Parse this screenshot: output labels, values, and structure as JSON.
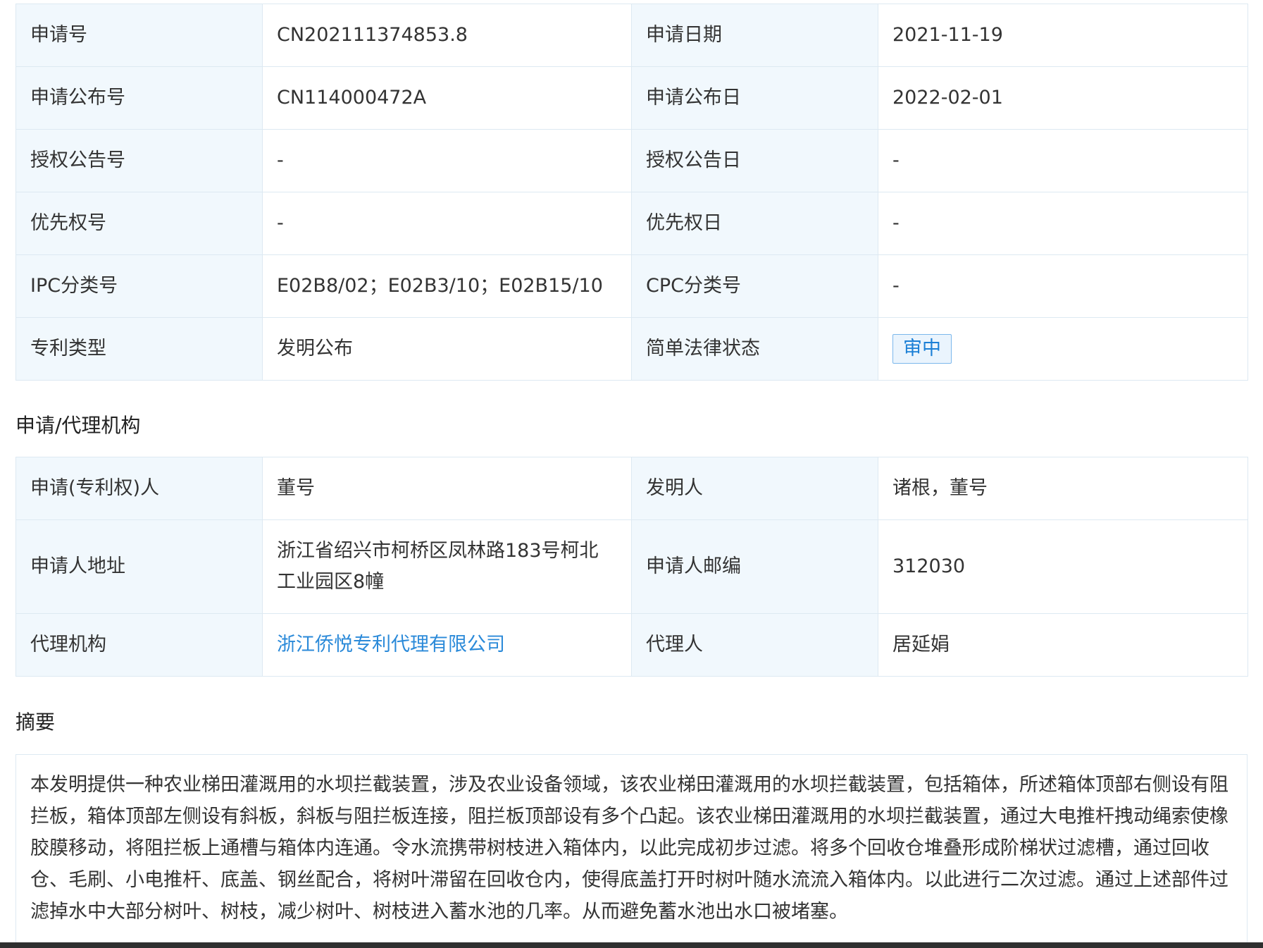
{
  "basic_info": {
    "rows": [
      {
        "k1": "申请号",
        "v1": "CN202111374853.8",
        "k2": "申请日期",
        "v2": "2021-11-19"
      },
      {
        "k1": "申请公布号",
        "v1": "CN114000472A",
        "k2": "申请公布日",
        "v2": "2022-02-01"
      },
      {
        "k1": "授权公告号",
        "v1": "-",
        "k2": "授权公告日",
        "v2": "-"
      },
      {
        "k1": "优先权号",
        "v1": "-",
        "k2": "优先权日",
        "v2": "-"
      },
      {
        "k1": "IPC分类号",
        "v1": "E02B8/02；E02B3/10；E02B15/10",
        "k2": "CPC分类号",
        "v2": "-"
      },
      {
        "k1": "专利类型",
        "v1": "发明公布",
        "k2": "简单法律状态",
        "v2": "审中"
      }
    ]
  },
  "agency_section": {
    "title": "申请/代理机构",
    "rows": [
      {
        "k1": "申请(专利权)人",
        "v1": "董号",
        "k2": "发明人",
        "v2": "诸根，董号"
      },
      {
        "k1": "申请人地址",
        "v1": "浙江省绍兴市柯桥区凤林路183号柯北工业园区8幢",
        "k2": "申请人邮编",
        "v2": "312030"
      },
      {
        "k1": "代理机构",
        "v1": "浙江侨悦专利代理有限公司",
        "k2": "代理人",
        "v2": "居延娟"
      }
    ]
  },
  "abstract_section": {
    "title": "摘要",
    "text": "本发明提供一种农业梯田灌溉用的水坝拦截装置，涉及农业设备领域，该农业梯田灌溉用的水坝拦截装置，包括箱体，所述箱体顶部右侧设有阻拦板，箱体顶部左侧设有斜板，斜板与阻拦板连接，阻拦板顶部设有多个凸起。该农业梯田灌溉用的水坝拦截装置，通过大电推杆拽动绳索使橡胶膜移动，将阻拦板上通槽与箱体内连通。令水流携带树枝进入箱体内，以此完成初步过滤。将多个回收仓堆叠形成阶梯状过滤槽，通过回收仓、毛刷、小电推杆、底盖、钢丝配合，将树叶滞留在回收仓内，使得底盖打开时树叶随水流流入箱体内。以此进行二次过滤。通过上述部件过滤掉水中大部分树叶、树枝，减少树叶、树枝进入蓄水池的几率。从而避免蓄水池出水口被堵塞。"
  },
  "colors": {
    "key_cell_bg": "#f1f8fd",
    "border": "#dde9f2",
    "link": "#2b8ad9",
    "badge_text": "#1b7fd6",
    "badge_border": "#7cb8ec"
  }
}
